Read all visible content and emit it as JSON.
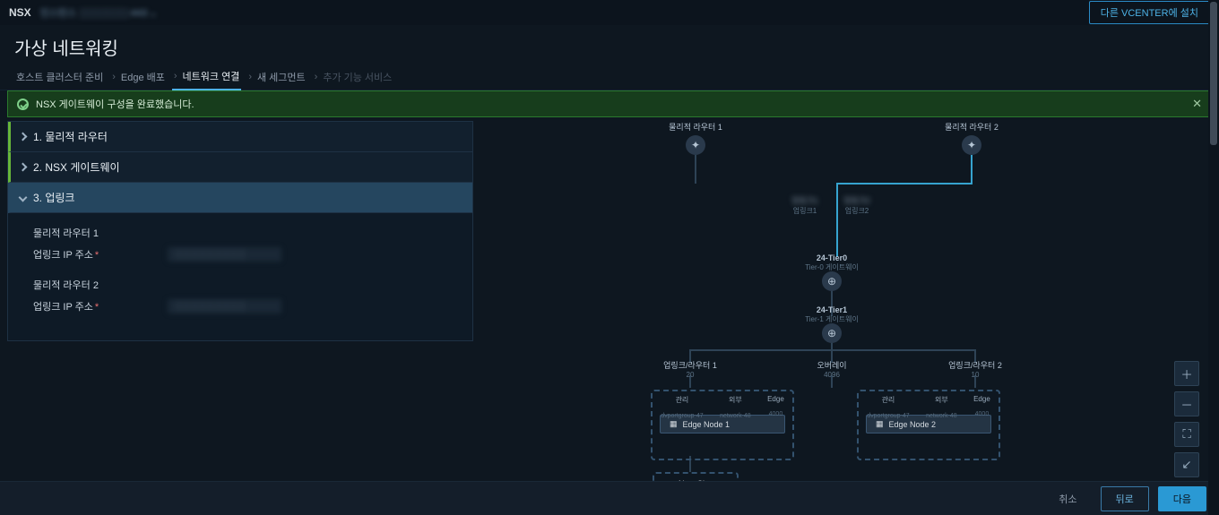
{
  "topbar": {
    "brand": "NSX",
    "instance": "인스턴스 ░░░░░░░:443",
    "install_btn": "다른 VCENTER에 설치"
  },
  "title": "가상 네트워킹",
  "steps": [
    "호스트 클러스터 준비",
    "Edge 배포",
    "네트워크 연결",
    "새 세그먼트",
    "추가 기능 서비스"
  ],
  "banner": {
    "text": "NSX 게이트웨이 구성을 완료했습니다."
  },
  "accordion": {
    "s1": "1. 물리적 라우터",
    "s2": "2. NSX 게이트웨이",
    "s3": "3. 업링크",
    "body": {
      "r1_label": "물리적 라우터 1",
      "r2_label": "물리적 라우터 2",
      "ip_label": "업링크 IP 주소",
      "r1_ip": "░░░░░░░░░",
      "r2_ip": "░░░░░░░░░"
    }
  },
  "graph": {
    "phys1": "물리적 라우터 1",
    "phys2": "물리적 라우터 2",
    "up1": "업링크1",
    "up2": "업링크2",
    "tier0": "24-Tier0",
    "tier0_sub": "Tier-0 게이트웨이",
    "tier1": "24-Tier1",
    "tier1_sub": "Tier-1 게이트웨이",
    "ul_r1": "업링크/라우터 1",
    "ul_r1_sub": "20",
    "ov": "오버레이",
    "ov_sub": "4096",
    "ul_r2": "업링크/라우터 2",
    "ul_r2_sub": "10",
    "col_mgmt": "관리",
    "col_mgmt_sub": "dvportgroup-47",
    "col_ext": "외부",
    "col_ext_sub": "network-48",
    "col_edge": "Edge",
    "col_edge_sub": "4000",
    "edge1": "Edge Node 1",
    "edge2": "Edge Node 2",
    "cluster": "New Cluster"
  },
  "footer": {
    "cancel": "취소",
    "back": "뒤로",
    "next": "다음"
  }
}
